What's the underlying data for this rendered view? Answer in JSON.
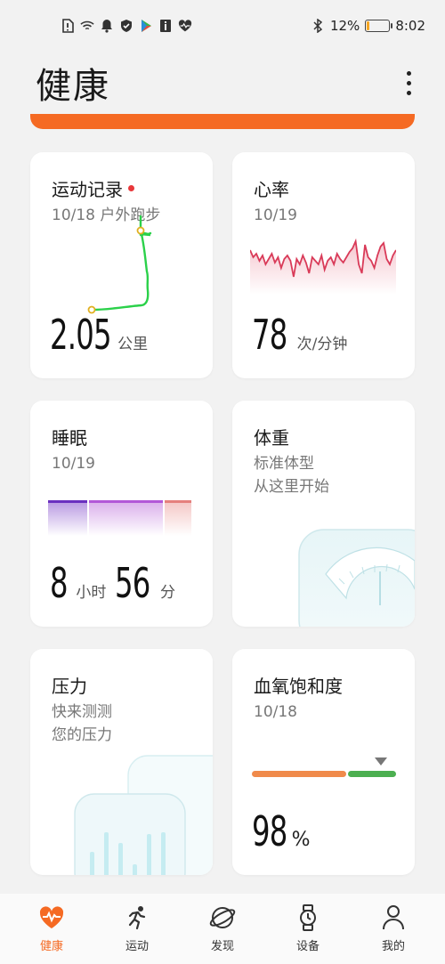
{
  "status": {
    "battery_pct": "12%",
    "battery_level": 0.12,
    "time": "8:02"
  },
  "header": {
    "title": "健康"
  },
  "cards": {
    "exercise": {
      "title": "运动记录",
      "subtitle": "10/18 户外跑步",
      "value": "2.05",
      "unit": "公里"
    },
    "heart": {
      "title": "心率",
      "date": "10/19",
      "value": "78",
      "unit": "次/分钟"
    },
    "sleep": {
      "title": "睡眠",
      "date": "10/19",
      "hours": "8",
      "hours_unit": "小时",
      "minutes": "56",
      "minutes_unit": "分"
    },
    "weight": {
      "title": "体重",
      "line1": "标准体型",
      "line2": "从这里开始"
    },
    "stress": {
      "title": "压力",
      "line1": "快来测测",
      "line2": "您的压力"
    },
    "spo2": {
      "title": "血氧饱和度",
      "date": "10/18",
      "value": "98",
      "unit": "%"
    }
  },
  "tabs": [
    {
      "label": "健康",
      "icon": "heart-pulse-icon",
      "active": true
    },
    {
      "label": "运动",
      "icon": "runner-icon",
      "active": false
    },
    {
      "label": "发现",
      "icon": "discover-planet-icon",
      "active": false
    },
    {
      "label": "设备",
      "icon": "watch-icon",
      "active": false
    },
    {
      "label": "我的",
      "icon": "person-icon",
      "active": false
    }
  ],
  "colors": {
    "accent": "#f56a23",
    "heart_line": "#d93a58",
    "route": "#2bd14a",
    "spo2_orange": "#f08a4b",
    "spo2_green": "#4caf50"
  }
}
